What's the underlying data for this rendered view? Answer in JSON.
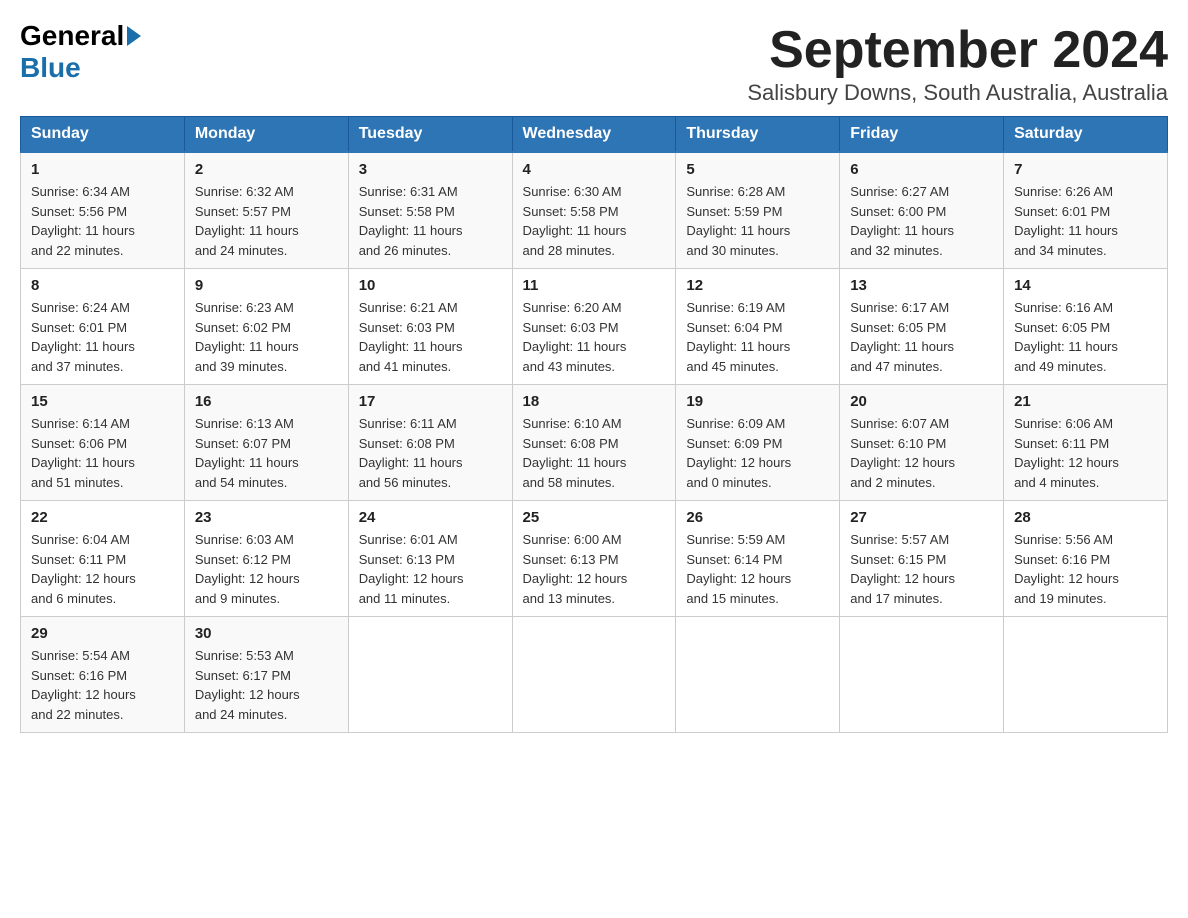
{
  "header": {
    "logo": {
      "general": "General",
      "blue": "Blue"
    },
    "title": "September 2024",
    "location": "Salisbury Downs, South Australia, Australia"
  },
  "days_of_week": [
    "Sunday",
    "Monday",
    "Tuesday",
    "Wednesday",
    "Thursday",
    "Friday",
    "Saturday"
  ],
  "weeks": [
    [
      {
        "day": "1",
        "sunrise": "6:34 AM",
        "sunset": "5:56 PM",
        "daylight": "11 hours and 22 minutes."
      },
      {
        "day": "2",
        "sunrise": "6:32 AM",
        "sunset": "5:57 PM",
        "daylight": "11 hours and 24 minutes."
      },
      {
        "day": "3",
        "sunrise": "6:31 AM",
        "sunset": "5:58 PM",
        "daylight": "11 hours and 26 minutes."
      },
      {
        "day": "4",
        "sunrise": "6:30 AM",
        "sunset": "5:58 PM",
        "daylight": "11 hours and 28 minutes."
      },
      {
        "day": "5",
        "sunrise": "6:28 AM",
        "sunset": "5:59 PM",
        "daylight": "11 hours and 30 minutes."
      },
      {
        "day": "6",
        "sunrise": "6:27 AM",
        "sunset": "6:00 PM",
        "daylight": "11 hours and 32 minutes."
      },
      {
        "day": "7",
        "sunrise": "6:26 AM",
        "sunset": "6:01 PM",
        "daylight": "11 hours and 34 minutes."
      }
    ],
    [
      {
        "day": "8",
        "sunrise": "6:24 AM",
        "sunset": "6:01 PM",
        "daylight": "11 hours and 37 minutes."
      },
      {
        "day": "9",
        "sunrise": "6:23 AM",
        "sunset": "6:02 PM",
        "daylight": "11 hours and 39 minutes."
      },
      {
        "day": "10",
        "sunrise": "6:21 AM",
        "sunset": "6:03 PM",
        "daylight": "11 hours and 41 minutes."
      },
      {
        "day": "11",
        "sunrise": "6:20 AM",
        "sunset": "6:03 PM",
        "daylight": "11 hours and 43 minutes."
      },
      {
        "day": "12",
        "sunrise": "6:19 AM",
        "sunset": "6:04 PM",
        "daylight": "11 hours and 45 minutes."
      },
      {
        "day": "13",
        "sunrise": "6:17 AM",
        "sunset": "6:05 PM",
        "daylight": "11 hours and 47 minutes."
      },
      {
        "day": "14",
        "sunrise": "6:16 AM",
        "sunset": "6:05 PM",
        "daylight": "11 hours and 49 minutes."
      }
    ],
    [
      {
        "day": "15",
        "sunrise": "6:14 AM",
        "sunset": "6:06 PM",
        "daylight": "11 hours and 51 minutes."
      },
      {
        "day": "16",
        "sunrise": "6:13 AM",
        "sunset": "6:07 PM",
        "daylight": "11 hours and 54 minutes."
      },
      {
        "day": "17",
        "sunrise": "6:11 AM",
        "sunset": "6:08 PM",
        "daylight": "11 hours and 56 minutes."
      },
      {
        "day": "18",
        "sunrise": "6:10 AM",
        "sunset": "6:08 PM",
        "daylight": "11 hours and 58 minutes."
      },
      {
        "day": "19",
        "sunrise": "6:09 AM",
        "sunset": "6:09 PM",
        "daylight": "12 hours and 0 minutes."
      },
      {
        "day": "20",
        "sunrise": "6:07 AM",
        "sunset": "6:10 PM",
        "daylight": "12 hours and 2 minutes."
      },
      {
        "day": "21",
        "sunrise": "6:06 AM",
        "sunset": "6:11 PM",
        "daylight": "12 hours and 4 minutes."
      }
    ],
    [
      {
        "day": "22",
        "sunrise": "6:04 AM",
        "sunset": "6:11 PM",
        "daylight": "12 hours and 6 minutes."
      },
      {
        "day": "23",
        "sunrise": "6:03 AM",
        "sunset": "6:12 PM",
        "daylight": "12 hours and 9 minutes."
      },
      {
        "day": "24",
        "sunrise": "6:01 AM",
        "sunset": "6:13 PM",
        "daylight": "12 hours and 11 minutes."
      },
      {
        "day": "25",
        "sunrise": "6:00 AM",
        "sunset": "6:13 PM",
        "daylight": "12 hours and 13 minutes."
      },
      {
        "day": "26",
        "sunrise": "5:59 AM",
        "sunset": "6:14 PM",
        "daylight": "12 hours and 15 minutes."
      },
      {
        "day": "27",
        "sunrise": "5:57 AM",
        "sunset": "6:15 PM",
        "daylight": "12 hours and 17 minutes."
      },
      {
        "day": "28",
        "sunrise": "5:56 AM",
        "sunset": "6:16 PM",
        "daylight": "12 hours and 19 minutes."
      }
    ],
    [
      {
        "day": "29",
        "sunrise": "5:54 AM",
        "sunset": "6:16 PM",
        "daylight": "12 hours and 22 minutes."
      },
      {
        "day": "30",
        "sunrise": "5:53 AM",
        "sunset": "6:17 PM",
        "daylight": "12 hours and 24 minutes."
      },
      null,
      null,
      null,
      null,
      null
    ]
  ],
  "labels": {
    "sunrise": "Sunrise:",
    "sunset": "Sunset:",
    "daylight": "Daylight:"
  }
}
